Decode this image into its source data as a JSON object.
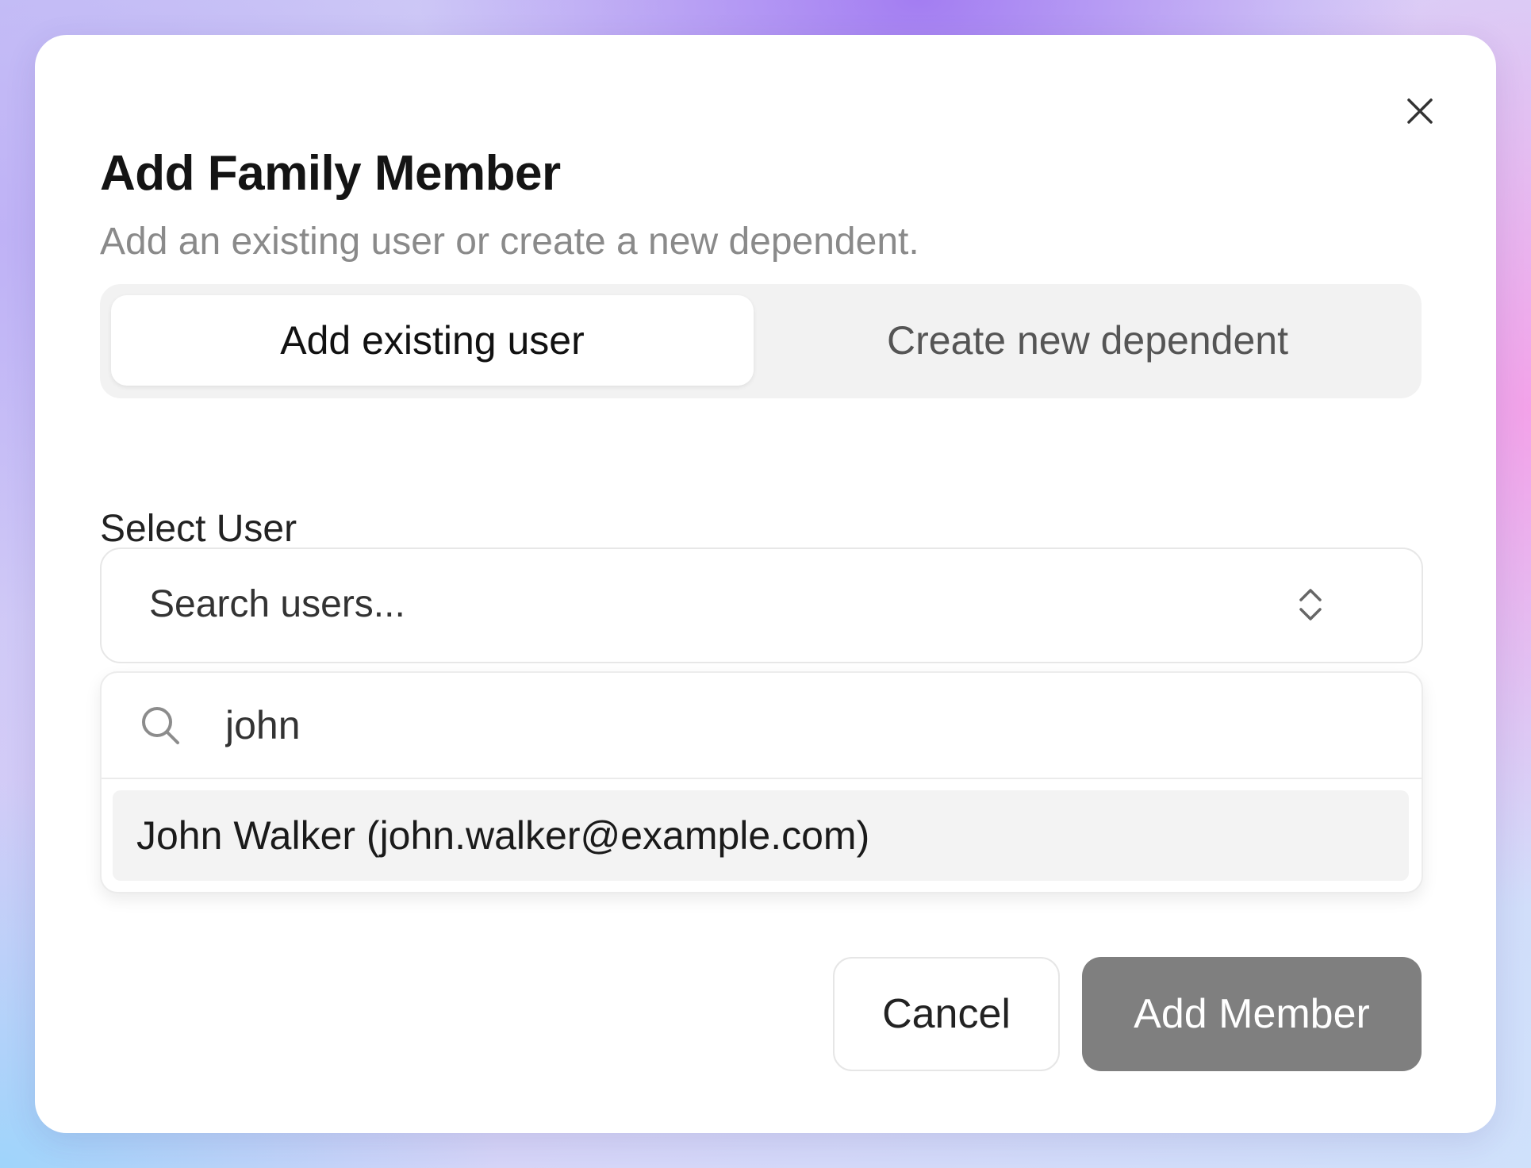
{
  "dialog": {
    "title": "Add Family Member",
    "subtitle": "Add an existing user or create a new dependent.",
    "close_icon": "close-icon"
  },
  "tabs": [
    {
      "label": "Add existing user",
      "active": true
    },
    {
      "label": "Create new dependent",
      "active": false
    }
  ],
  "select_user": {
    "label": "Select User",
    "placeholder": "Search users...",
    "chevron_icon": "chevron-up-down-icon"
  },
  "dropdown": {
    "search_icon": "search-icon",
    "search_value": "john",
    "options": [
      {
        "label": "John Walker (john.walker@example.com)",
        "highlighted": true
      }
    ]
  },
  "actions": {
    "cancel_label": "Cancel",
    "submit_label": "Add Member"
  },
  "colors": {
    "primary_button": "#7f7f7f",
    "tab_track": "#f2f2f2",
    "highlight": "#f3f3f3"
  }
}
